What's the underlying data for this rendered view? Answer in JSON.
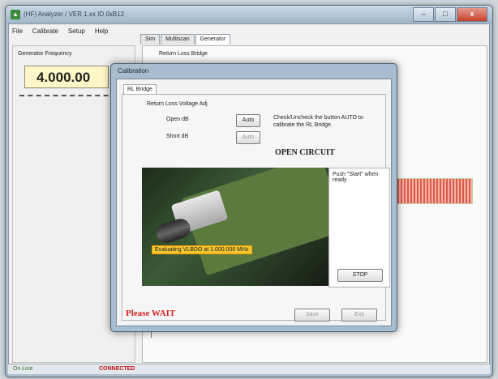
{
  "window": {
    "title": "(HF) Analyzer  /  VER 1.xx  ID 0xB12"
  },
  "title_buttons": {
    "minimize": "–",
    "maximize": "□",
    "close": "x"
  },
  "menu": {
    "items": [
      "File",
      "Calibrate",
      "Setup",
      "Help"
    ]
  },
  "tabs": [
    "Sim",
    "Multiscan",
    "Generator"
  ],
  "left_panel": {
    "label": "Generator Frequency",
    "frequency": "4.000.00"
  },
  "right_panel": {
    "heading": "Return Loss Bridge"
  },
  "status_bar": {
    "online": "On Line",
    "connection": "CONNECTED"
  },
  "dialog": {
    "title": "Calibration",
    "tab": "RL Bridge",
    "group_label": "Return Loss Voltage Adj",
    "open_label": "Open dB",
    "short_label": "Short dB",
    "auto_label": "Auto",
    "auto_label_disabled": "Auto",
    "hint": "Check/Uncheck the button AUTO to calibrate the RL Bridge.",
    "mode": "OPEN CIRCUIT",
    "caption": "Evaluating VLBDO at 1.000.000 MHz",
    "ready": "Push \"Start\" when ready",
    "stop_label": "STOP",
    "wait_message": "Please WAIT",
    "save_label": "Save",
    "exit_label": "Exit"
  }
}
